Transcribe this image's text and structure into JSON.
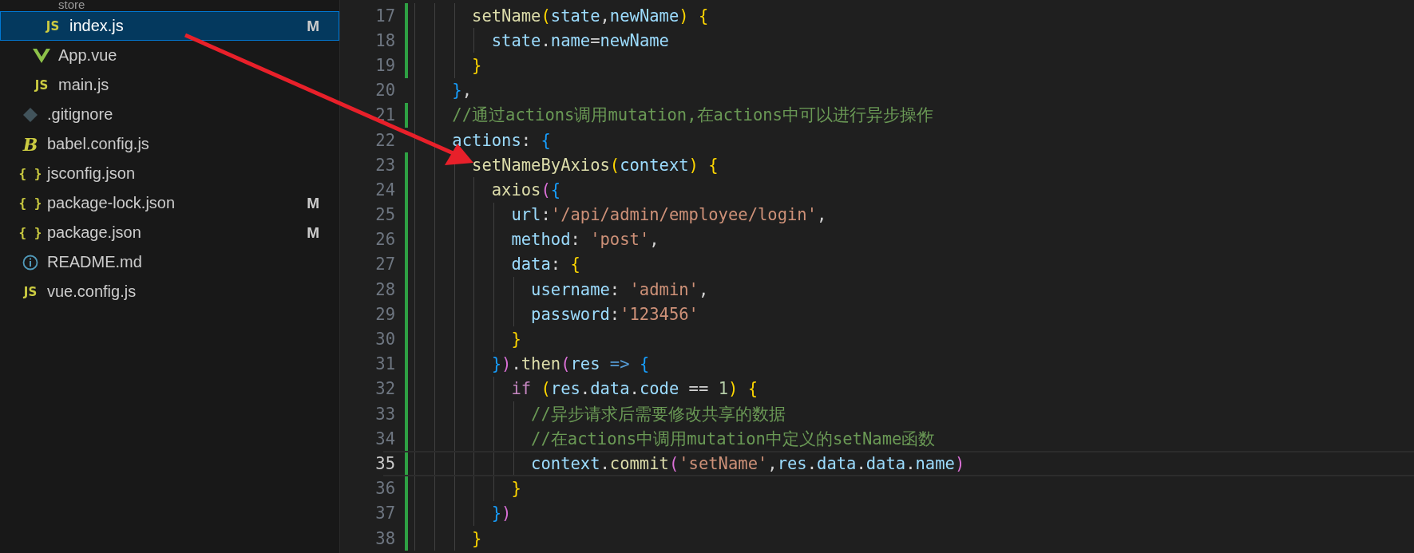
{
  "explorer": {
    "folder_contents": [
      {
        "name": "store",
        "kind": "folder",
        "selected": false,
        "children": [
          {
            "name": "index.js",
            "kind": "js",
            "icon_label": "JS",
            "git_status": "M",
            "selected": true
          }
        ]
      },
      {
        "name": "App.vue",
        "kind": "vue",
        "selected": false
      },
      {
        "name": "main.js",
        "kind": "js",
        "icon_label": "JS",
        "selected": false
      }
    ],
    "root_files": [
      {
        "name": ".gitignore",
        "kind": "git",
        "selected": false
      },
      {
        "name": "babel.config.js",
        "kind": "babel",
        "icon_label": "B",
        "selected": false
      },
      {
        "name": "jsconfig.json",
        "kind": "json",
        "icon_label": "{ }",
        "selected": false
      },
      {
        "name": "package-lock.json",
        "kind": "json",
        "icon_label": "{ }",
        "git_status": "M",
        "selected": false
      },
      {
        "name": "package.json",
        "kind": "json",
        "icon_label": "{ }",
        "git_status": "M",
        "selected": false
      },
      {
        "name": "README.md",
        "kind": "info",
        "selected": false
      },
      {
        "name": "vue.config.js",
        "kind": "js",
        "icon_label": "JS",
        "selected": false
      }
    ]
  },
  "editor": {
    "lines": [
      {
        "number": "17",
        "changed": true,
        "current": false,
        "tokens": [
          {
            "kind": "func",
            "text": "      setName"
          },
          {
            "kind": "b1",
            "text": "("
          },
          {
            "kind": "var",
            "text": "state"
          },
          {
            "kind": "plain",
            "text": ","
          },
          {
            "kind": "var",
            "text": "newName"
          },
          {
            "kind": "b1",
            "text": ")"
          },
          {
            "kind": "b1",
            "text": " {"
          }
        ]
      },
      {
        "number": "18",
        "changed": true,
        "current": false,
        "tokens": [
          {
            "kind": "var",
            "text": "        state"
          },
          {
            "kind": "plain",
            "text": "."
          },
          {
            "kind": "var",
            "text": "name"
          },
          {
            "kind": "plain",
            "text": "="
          },
          {
            "kind": "var",
            "text": "newName"
          }
        ]
      },
      {
        "number": "19",
        "changed": true,
        "current": false,
        "tokens": [
          {
            "kind": "b1",
            "text": "      }"
          }
        ]
      },
      {
        "number": "20",
        "changed": false,
        "current": false,
        "tokens": [
          {
            "kind": "b3",
            "text": "    }"
          },
          {
            "kind": "plain",
            "text": ","
          }
        ]
      },
      {
        "number": "21",
        "changed": true,
        "current": false,
        "tokens": [
          {
            "kind": "comment",
            "text": "    //通过actions调用mutation,在actions中可以进行异步操作"
          }
        ]
      },
      {
        "number": "22",
        "changed": false,
        "current": false,
        "tokens": [
          {
            "kind": "var",
            "text": "    actions"
          },
          {
            "kind": "plain",
            "text": ":"
          },
          {
            "kind": "b3",
            "text": " {"
          }
        ]
      },
      {
        "number": "23",
        "changed": true,
        "current": false,
        "tokens": [
          {
            "kind": "func",
            "text": "      setNameByAxios"
          },
          {
            "kind": "b1",
            "text": "("
          },
          {
            "kind": "var",
            "text": "context"
          },
          {
            "kind": "b1",
            "text": ")"
          },
          {
            "kind": "b1",
            "text": " {"
          }
        ]
      },
      {
        "number": "24",
        "changed": true,
        "current": false,
        "tokens": [
          {
            "kind": "func",
            "text": "        axios"
          },
          {
            "kind": "b2",
            "text": "("
          },
          {
            "kind": "b3",
            "text": "{"
          }
        ]
      },
      {
        "number": "25",
        "changed": true,
        "current": false,
        "tokens": [
          {
            "kind": "var",
            "text": "          url"
          },
          {
            "kind": "plain",
            "text": ":"
          },
          {
            "kind": "string",
            "text": "'/api/admin/employee/login'"
          },
          {
            "kind": "plain",
            "text": ","
          }
        ]
      },
      {
        "number": "26",
        "changed": true,
        "current": false,
        "tokens": [
          {
            "kind": "var",
            "text": "          method"
          },
          {
            "kind": "plain",
            "text": ":"
          },
          {
            "kind": "string",
            "text": " 'post'"
          },
          {
            "kind": "plain",
            "text": ","
          }
        ]
      },
      {
        "number": "27",
        "changed": true,
        "current": false,
        "tokens": [
          {
            "kind": "var",
            "text": "          data"
          },
          {
            "kind": "plain",
            "text": ":"
          },
          {
            "kind": "b1",
            "text": " {"
          }
        ]
      },
      {
        "number": "28",
        "changed": true,
        "current": false,
        "tokens": [
          {
            "kind": "var",
            "text": "            username"
          },
          {
            "kind": "plain",
            "text": ":"
          },
          {
            "kind": "string",
            "text": " 'admin'"
          },
          {
            "kind": "plain",
            "text": ","
          }
        ]
      },
      {
        "number": "29",
        "changed": true,
        "current": false,
        "tokens": [
          {
            "kind": "var",
            "text": "            password"
          },
          {
            "kind": "plain",
            "text": ":"
          },
          {
            "kind": "string",
            "text": "'123456'"
          }
        ]
      },
      {
        "number": "30",
        "changed": true,
        "current": false,
        "tokens": [
          {
            "kind": "b1",
            "text": "          }"
          }
        ]
      },
      {
        "number": "31",
        "changed": true,
        "current": false,
        "tokens": [
          {
            "kind": "b3",
            "text": "        }"
          },
          {
            "kind": "b2",
            "text": ")"
          },
          {
            "kind": "plain",
            "text": "."
          },
          {
            "kind": "func",
            "text": "then"
          },
          {
            "kind": "b2",
            "text": "("
          },
          {
            "kind": "var",
            "text": "res"
          },
          {
            "kind": "arrow",
            "text": " => "
          },
          {
            "kind": "b3",
            "text": "{"
          }
        ]
      },
      {
        "number": "32",
        "changed": true,
        "current": false,
        "tokens": [
          {
            "kind": "keyword",
            "text": "          if"
          },
          {
            "kind": "b1",
            "text": " ("
          },
          {
            "kind": "var",
            "text": "res"
          },
          {
            "kind": "plain",
            "text": "."
          },
          {
            "kind": "var",
            "text": "data"
          },
          {
            "kind": "plain",
            "text": "."
          },
          {
            "kind": "var",
            "text": "code"
          },
          {
            "kind": "plain",
            "text": " == "
          },
          {
            "kind": "number",
            "text": "1"
          },
          {
            "kind": "b1",
            "text": ")"
          },
          {
            "kind": "b1",
            "text": " {"
          }
        ]
      },
      {
        "number": "33",
        "changed": true,
        "current": false,
        "tokens": [
          {
            "kind": "comment",
            "text": "            //异步请求后需要修改共享的数据"
          }
        ]
      },
      {
        "number": "34",
        "changed": true,
        "current": false,
        "tokens": [
          {
            "kind": "comment",
            "text": "            //在actions中调用mutation中定义的setName函数"
          }
        ]
      },
      {
        "number": "35",
        "changed": true,
        "current": true,
        "tokens": [
          {
            "kind": "var",
            "text": "            context"
          },
          {
            "kind": "plain",
            "text": "."
          },
          {
            "kind": "func",
            "text": "commit"
          },
          {
            "kind": "b2",
            "text": "("
          },
          {
            "kind": "string",
            "text": "'setName'"
          },
          {
            "kind": "plain",
            "text": ","
          },
          {
            "kind": "var",
            "text": "res"
          },
          {
            "kind": "plain",
            "text": "."
          },
          {
            "kind": "var",
            "text": "data"
          },
          {
            "kind": "plain",
            "text": "."
          },
          {
            "kind": "var",
            "text": "data"
          },
          {
            "kind": "plain",
            "text": "."
          },
          {
            "kind": "var",
            "text": "name"
          },
          {
            "kind": "b2",
            "text": ")"
          }
        ]
      },
      {
        "number": "36",
        "changed": true,
        "current": false,
        "tokens": [
          {
            "kind": "b1",
            "text": "          }"
          }
        ]
      },
      {
        "number": "37",
        "changed": true,
        "current": false,
        "tokens": [
          {
            "kind": "b3",
            "text": "        }"
          },
          {
            "kind": "b2",
            "text": ")"
          }
        ]
      },
      {
        "number": "38",
        "changed": true,
        "current": false,
        "tokens": [
          {
            "kind": "b1",
            "text": "      }"
          }
        ]
      }
    ]
  }
}
